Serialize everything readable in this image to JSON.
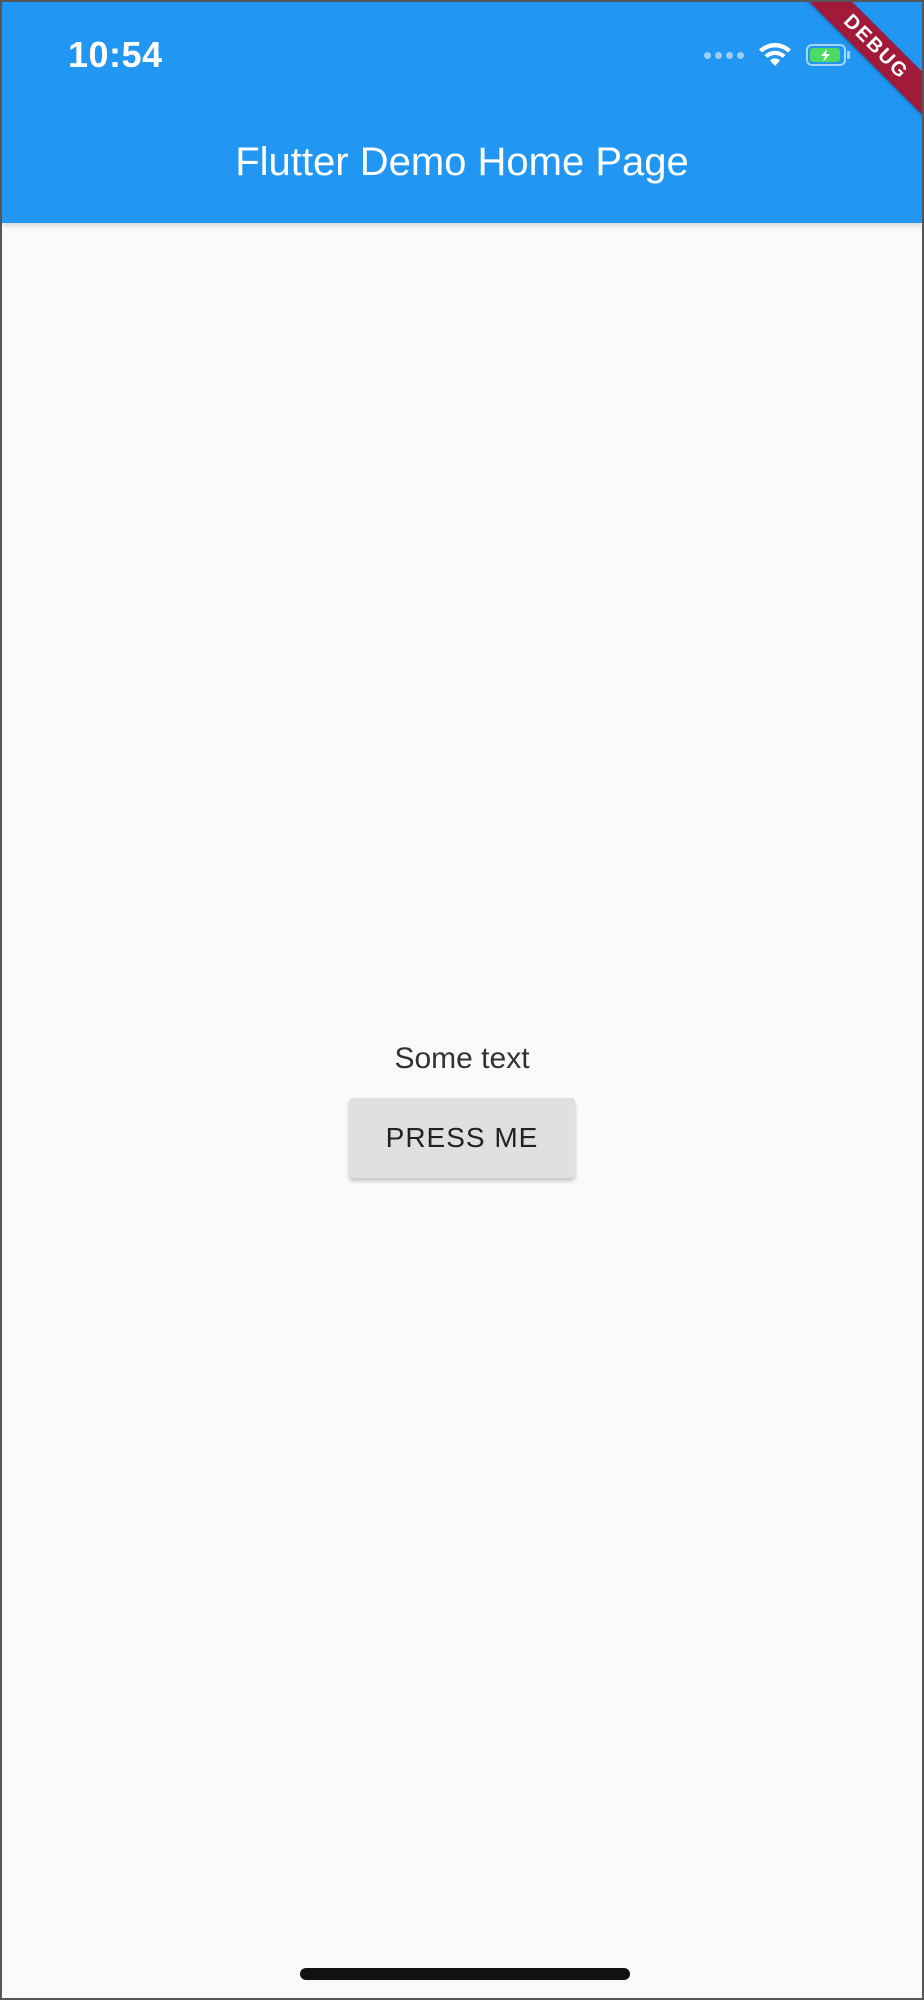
{
  "status_bar": {
    "time": "10:54",
    "icons": [
      "signal-dots-icon",
      "wifi-icon",
      "battery-charging-icon"
    ]
  },
  "app_bar": {
    "title": "Flutter Demo Home Page",
    "color": "#2196f3"
  },
  "debug_banner": {
    "label": "DEBUG",
    "color": "#a21a3a"
  },
  "main": {
    "text": "Some text",
    "button_label": "PRESS ME"
  }
}
